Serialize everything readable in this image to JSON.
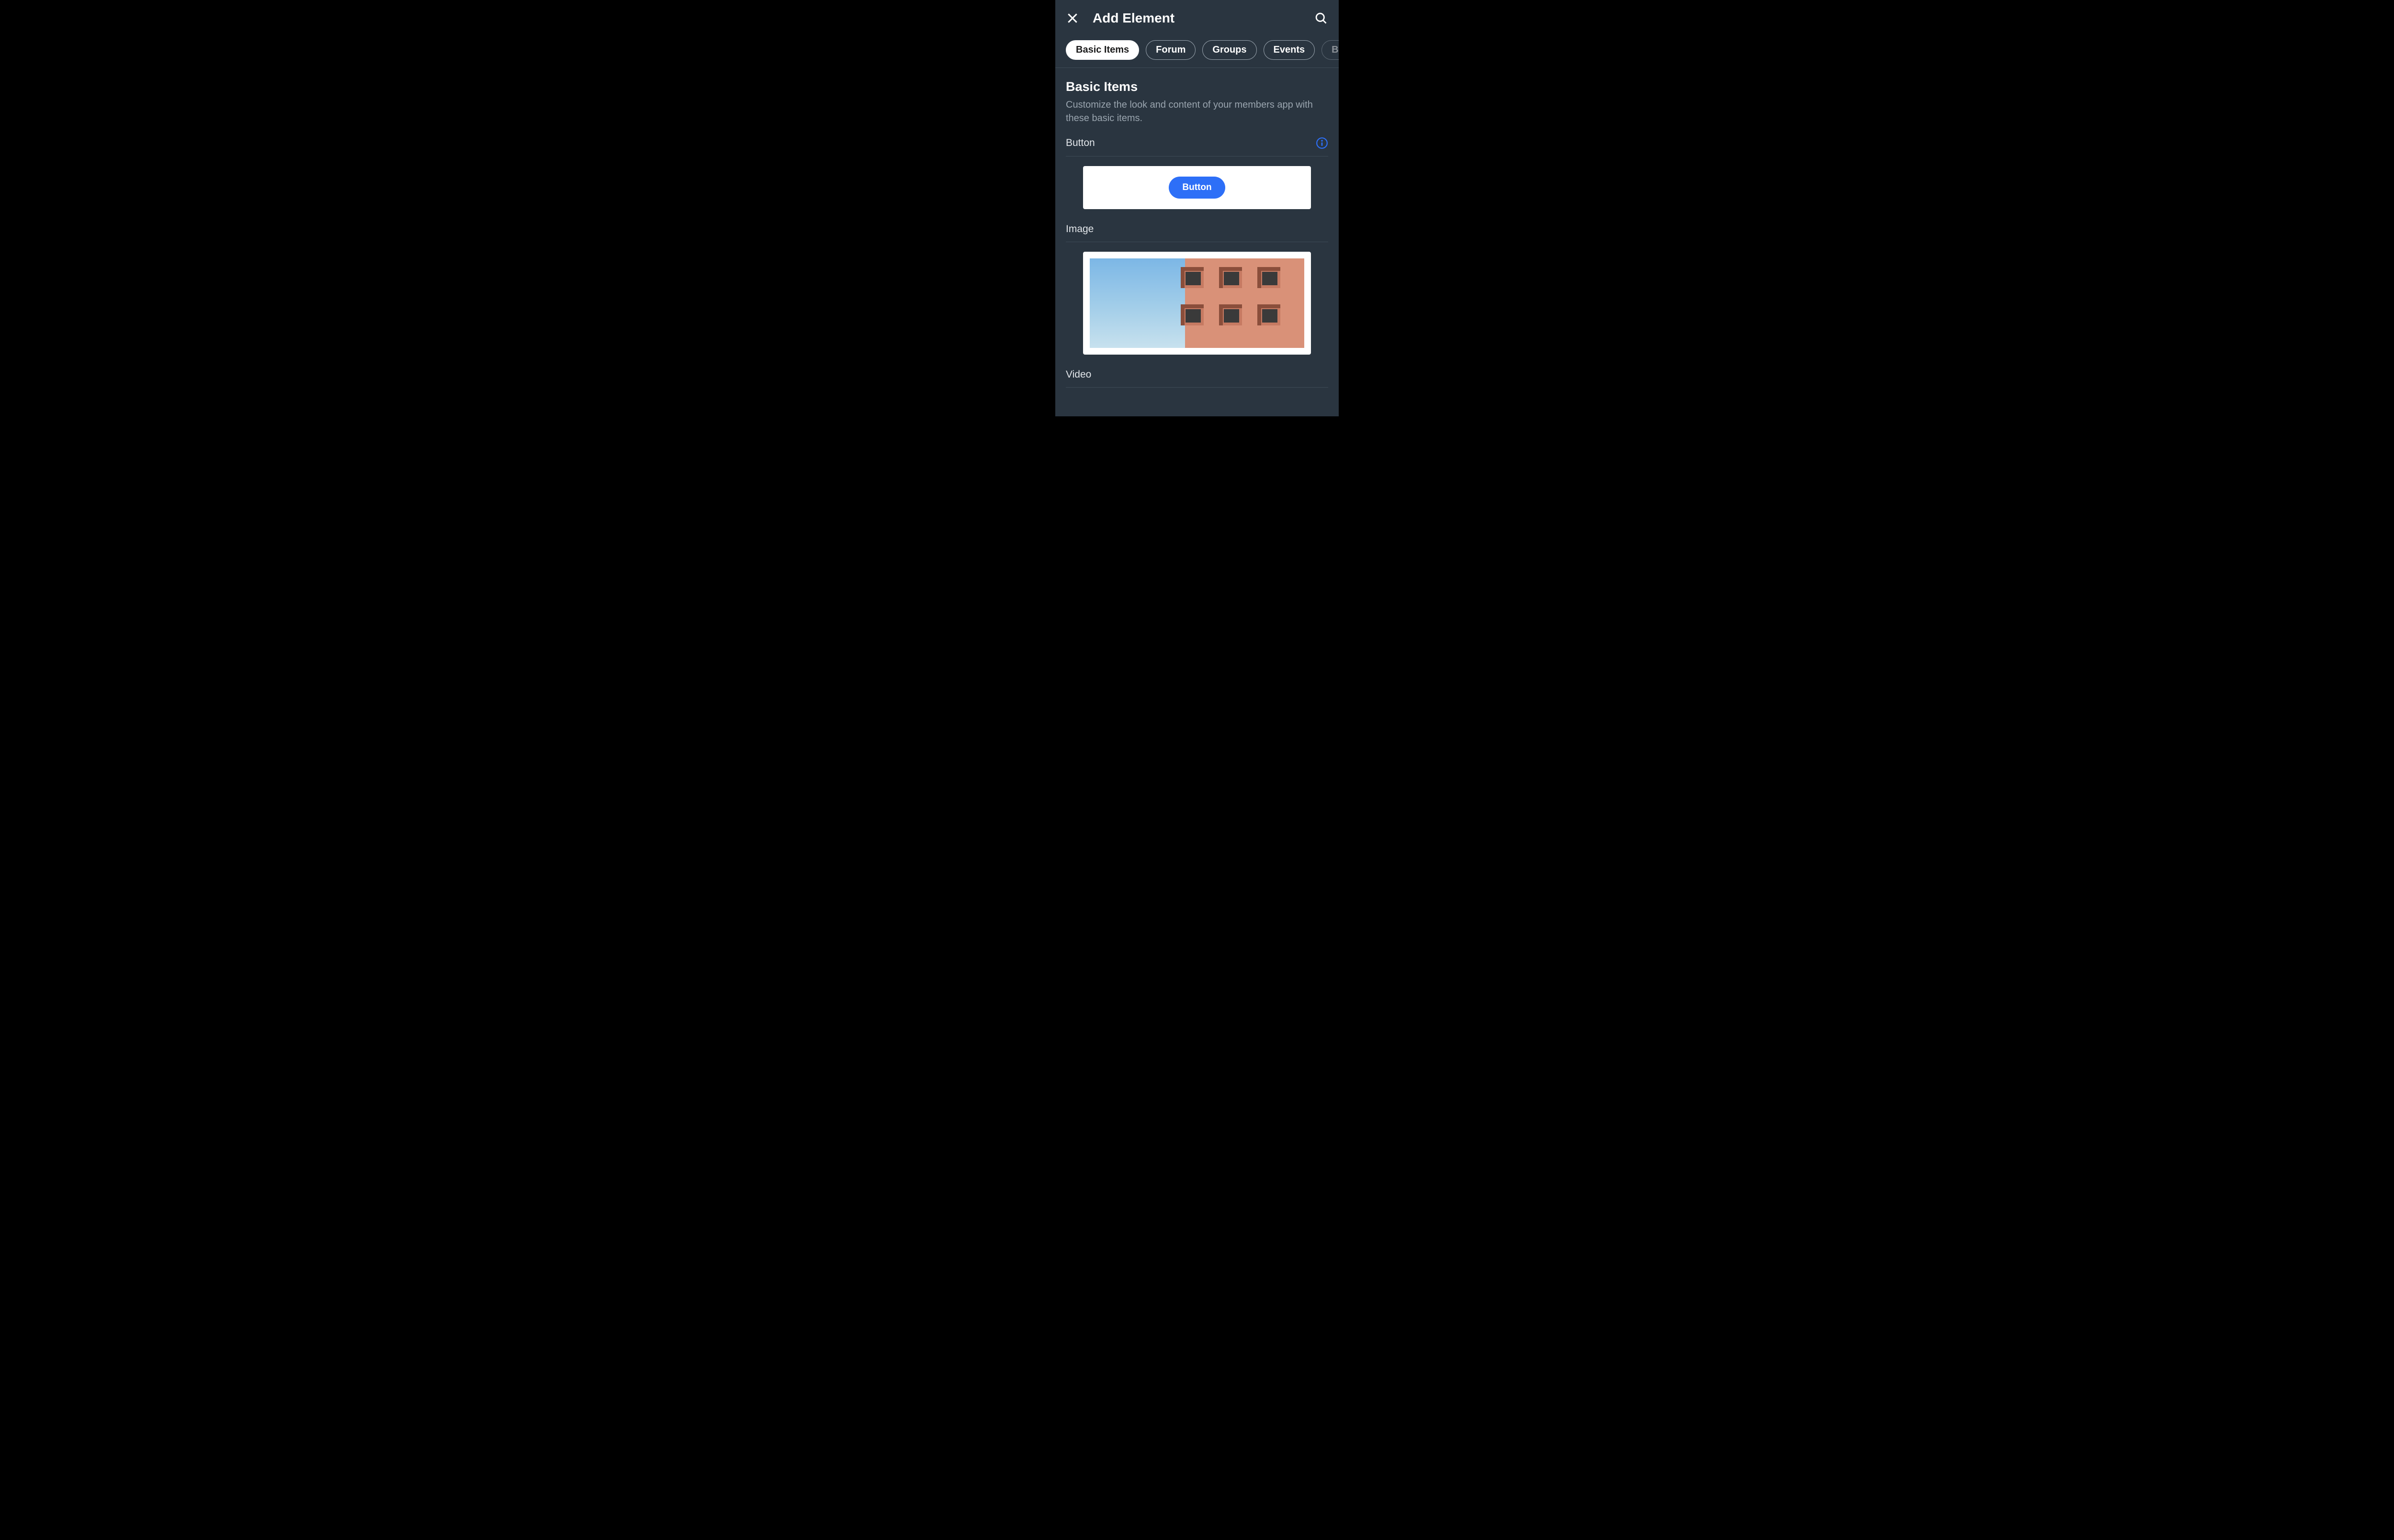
{
  "header": {
    "title": "Add Element"
  },
  "tabs": [
    {
      "label": "Basic Items",
      "active": true
    },
    {
      "label": "Forum",
      "active": false
    },
    {
      "label": "Groups",
      "active": false
    },
    {
      "label": "Events",
      "active": false
    },
    {
      "label": "Blog",
      "active": false,
      "dim": true
    }
  ],
  "section": {
    "heading": "Basic Items",
    "description": "Customize the look and content of your members app with these basic items."
  },
  "items": [
    {
      "label": "Button",
      "has_info": true,
      "preview_button_label": "Button"
    },
    {
      "label": "Image",
      "has_info": false
    },
    {
      "label": "Video",
      "has_info": false
    }
  ]
}
